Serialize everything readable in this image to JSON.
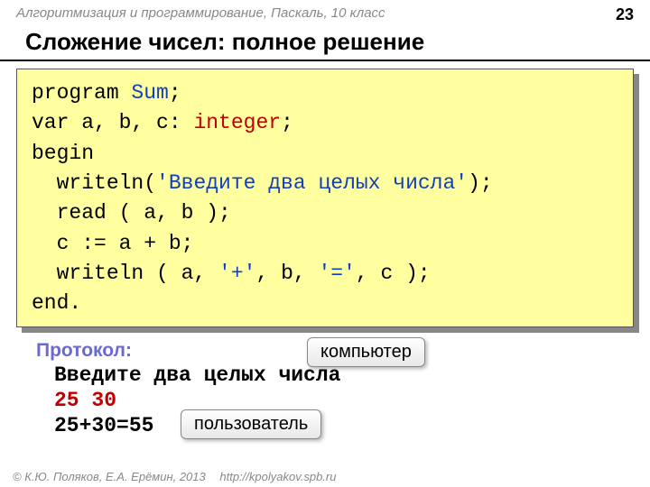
{
  "header": {
    "course": "Алгоритмизация и программирование, Паскаль, 10 класс",
    "page": "23"
  },
  "title": "Сложение чисел: полное решение",
  "code": {
    "l1a": "program ",
    "l1b": "Sum",
    "l1c": ";",
    "l2a": "var a, b, c: ",
    "l2b": "integer",
    "l2c": ";",
    "l3": "begin",
    "l4a": "  writeln(",
    "l4b": "'Введите два целых числа'",
    "l4c": ");",
    "l5": "  read ( a, b );",
    "l6": "  c := a + b;",
    "l7a": "  writeln ( a, ",
    "l7b": "'+'",
    "l7c": ", b, ",
    "l7d": "'='",
    "l7e": ", c );",
    "l8": "end."
  },
  "protocol": {
    "label": "Протокол:",
    "line1": "Введите два целых числа",
    "line2": "25 30",
    "line3": "25+30=55"
  },
  "callouts": {
    "computer": "компьютер",
    "user": "пользователь"
  },
  "footer": {
    "copyright": "© К.Ю. Поляков, Е.А. Ерёмин, 2013",
    "url": "http://kpolyakov.spb.ru"
  }
}
